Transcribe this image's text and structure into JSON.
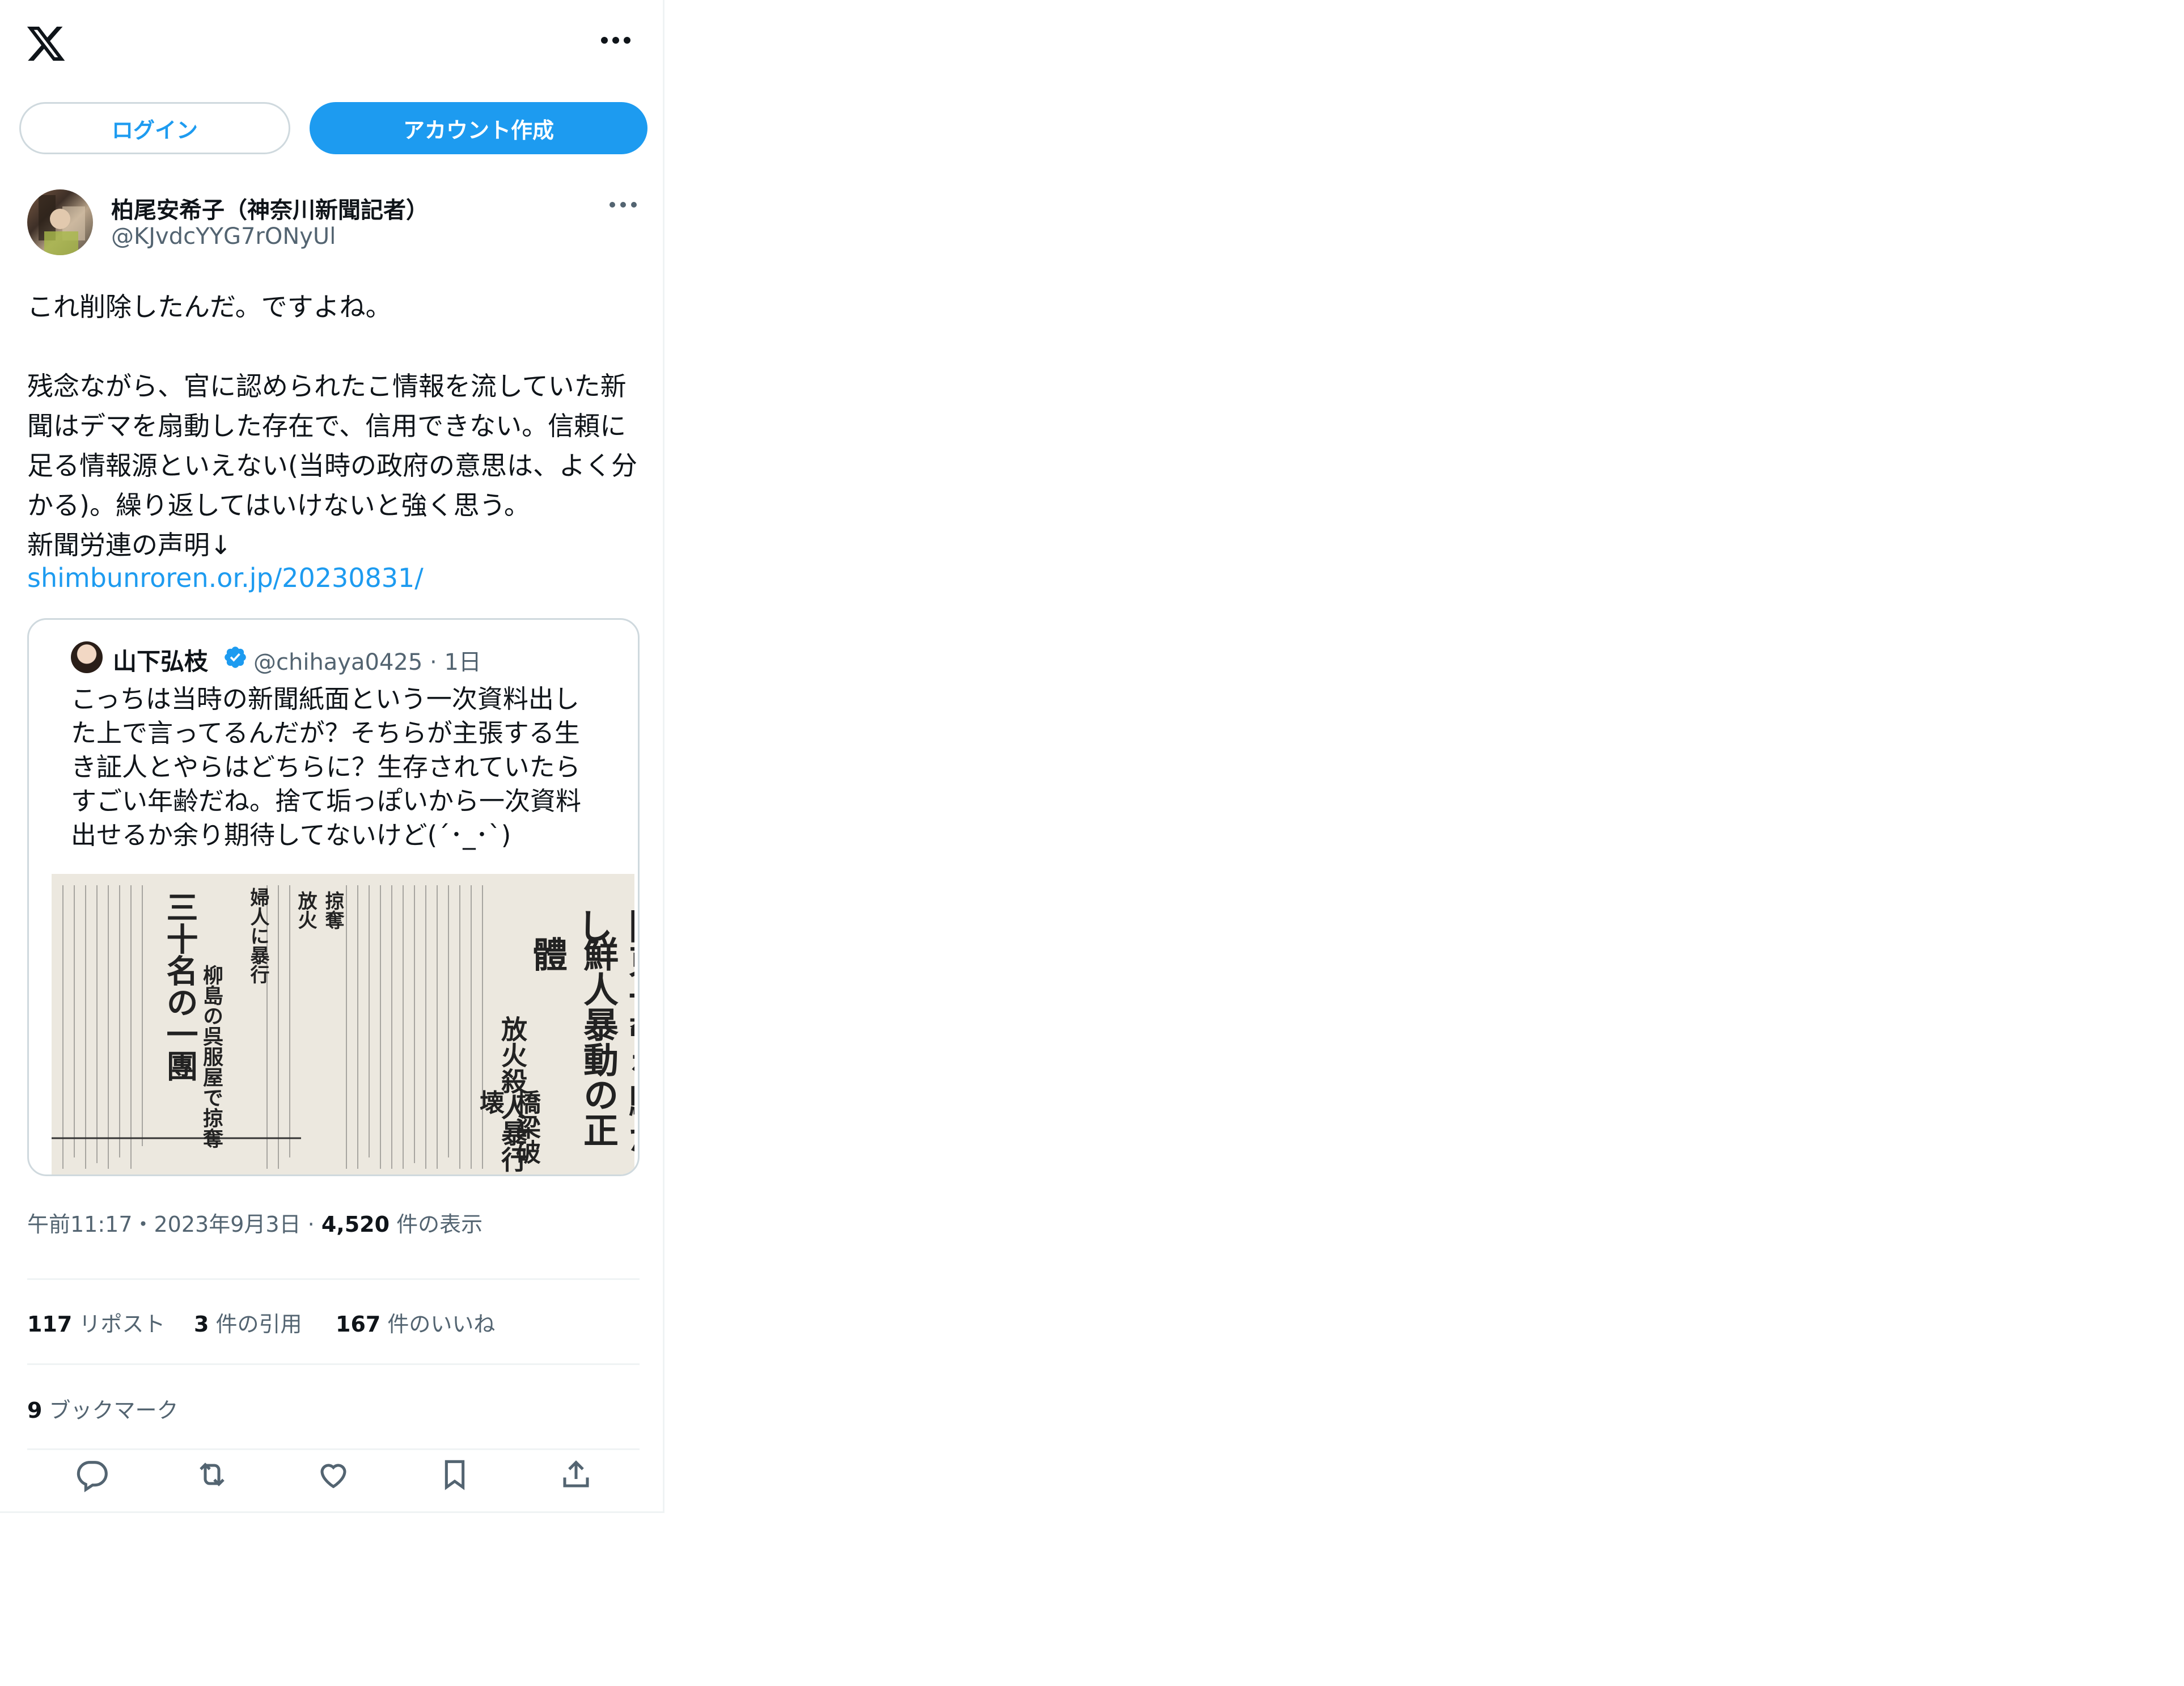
{
  "header": {
    "logo_icon": "x-logo-icon",
    "more_icon": "more-horizontal-icon"
  },
  "auth": {
    "login_label": "ログイン",
    "signup_label": "アカウント作成",
    "accent": "#1d9bf0"
  },
  "tweet": {
    "author_name": "柏尾安希子（神奈川新聞記者）",
    "author_handle": "@KJvdcYYG7rONyUl",
    "text": "これ削除したんだ。ですよね。\n\n残念ながら、官に認められたこ情報を流していた新聞はデマを扇動した存在で、信用できない。信頼に足る情報源といえない(当時の政府の意思は、よく分かる)。繰り返してはいけないと強く思う。\n新聞労連の声明↓",
    "link": "shimbunroren.or.jp/20230831/",
    "quoted": {
      "author_name": "山下弘枝",
      "author_handle": "@chihaya0425 · 1日",
      "verified_icon": "verified-badge-icon",
      "text": "こっちは当時の新聞紙面という一次資料出した上で言ってるんだが？そちらが主張する生き証人とやらはどちらに？生存されていたらすごい年齢だね。捨て垢っぽいから一次資料出せるか余り期待してないけど(´･_･`)",
      "image": {
        "headline_1": "關東一帶を騷がし",
        "headline_2": "鮮人暴動の正體",
        "headline_3": "放火殺人暴行",
        "headline_4": "橋梁破壊",
        "sub_1": "掠奪",
        "sub_2": "放火",
        "sub_3": "婦人に暴行",
        "sub_4": "三十名の一團",
        "sub_5": "柳島の呉服屋で掠奪"
      }
    },
    "time": "午前11:17・2023年9月3日",
    "views_count": "4,520",
    "views_label": "件の表示",
    "reposts_count": "117",
    "reposts_label": "リポスト",
    "quotes_count": "3",
    "quotes_label": "件の引用",
    "likes_count": "167",
    "likes_label": "件のいいね",
    "bookmarks_count": "9",
    "bookmarks_label": "ブックマーク"
  },
  "actions": [
    "reply-icon",
    "repost-icon",
    "like-icon",
    "bookmark-icon",
    "share-icon"
  ]
}
